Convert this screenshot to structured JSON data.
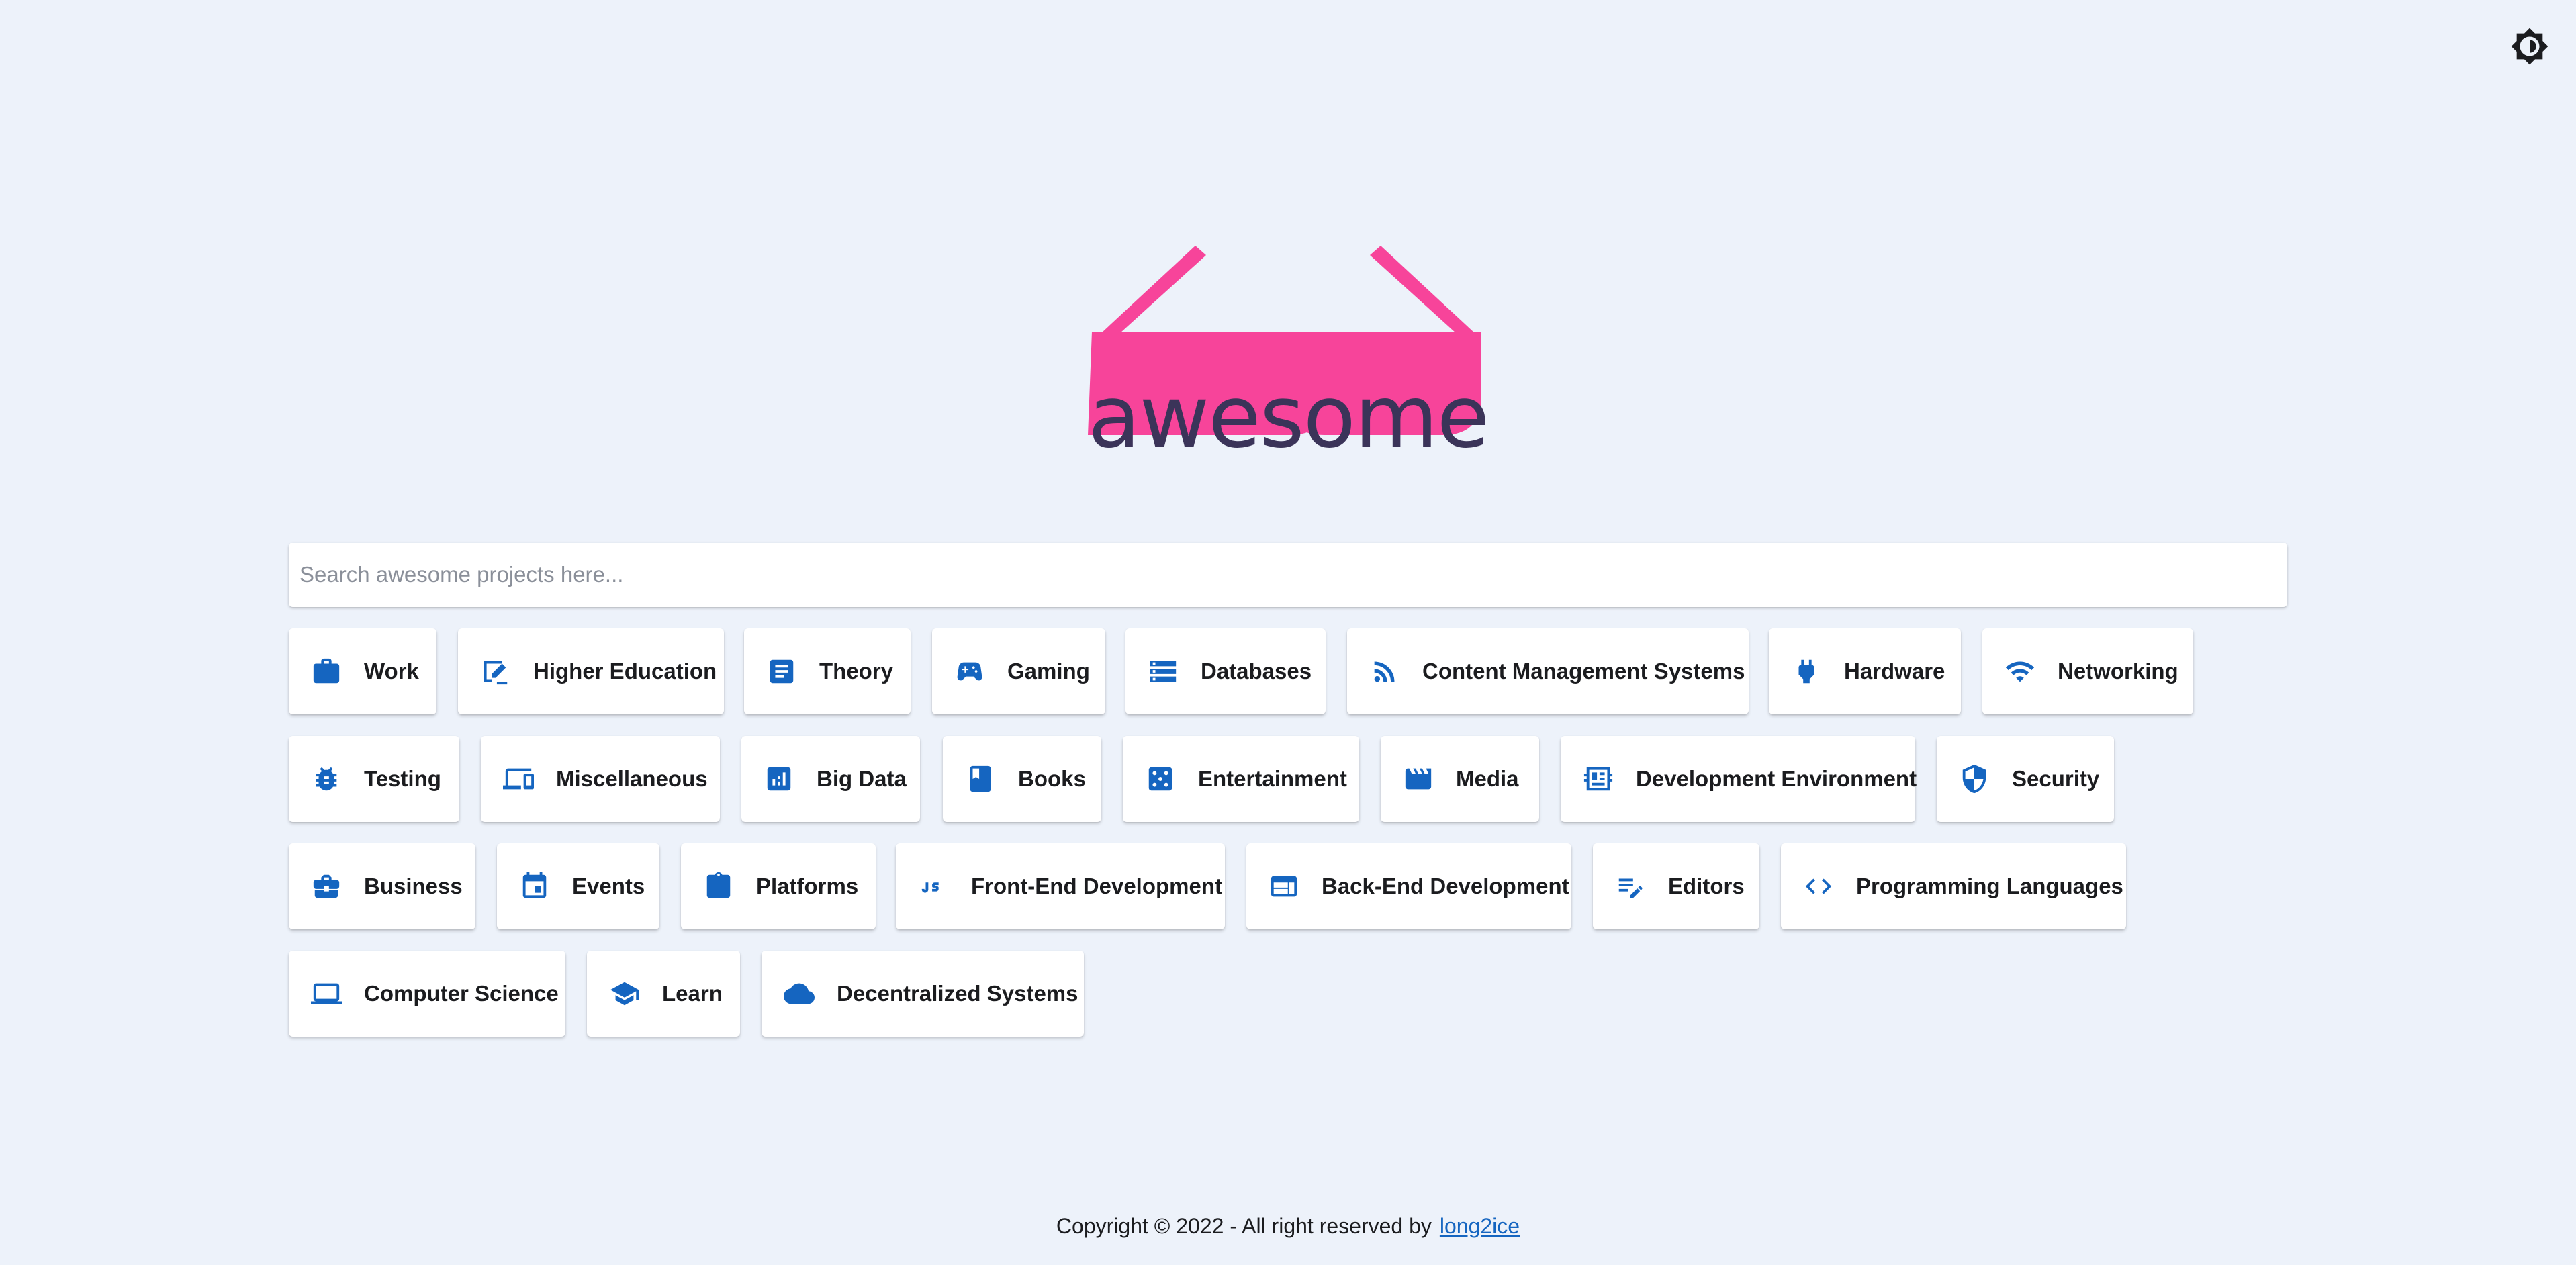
{
  "header": {
    "theme_toggle_icon": "brightness-icon",
    "logo_text": "awesome",
    "logo_color": "#f7449a",
    "wordmark_color": "#3b3459"
  },
  "search": {
    "placeholder": "Search awesome projects here...",
    "value": ""
  },
  "accent_color": "#1565c0",
  "categories": [
    {
      "label": "Work",
      "icon": "briefcase-icon"
    },
    {
      "label": "Higher Education",
      "icon": "draw-icon"
    },
    {
      "label": "Theory",
      "icon": "article-icon"
    },
    {
      "label": "Gaming",
      "icon": "gamepad-icon"
    },
    {
      "label": "Databases",
      "icon": "storage-icon"
    },
    {
      "label": "Content Management Systems",
      "icon": "rss-icon"
    },
    {
      "label": "Hardware",
      "icon": "plug-icon"
    },
    {
      "label": "Networking",
      "icon": "wifi-icon"
    },
    {
      "label": "Testing",
      "icon": "bug-icon"
    },
    {
      "label": "Miscellaneous",
      "icon": "devices-icon"
    },
    {
      "label": "Big Data",
      "icon": "chart-icon"
    },
    {
      "label": "Books",
      "icon": "book-icon"
    },
    {
      "label": "Entertainment",
      "icon": "dice-icon"
    },
    {
      "label": "Media",
      "icon": "movie-icon"
    },
    {
      "label": "Development Environment",
      "icon": "dashboard-icon"
    },
    {
      "label": "Security",
      "icon": "shield-icon"
    },
    {
      "label": "Business",
      "icon": "business-case-icon"
    },
    {
      "label": "Events",
      "icon": "event-icon"
    },
    {
      "label": "Platforms",
      "icon": "integration-icon"
    },
    {
      "label": "Front-End Development",
      "icon": "javascript-icon"
    },
    {
      "label": "Back-End Development",
      "icon": "web-window-icon"
    },
    {
      "label": "Editors",
      "icon": "edit-note-icon"
    },
    {
      "label": "Programming Languages",
      "icon": "code-icon"
    },
    {
      "label": "Computer Science",
      "icon": "laptop-icon"
    },
    {
      "label": "Learn",
      "icon": "school-icon"
    },
    {
      "label": "Decentralized Systems",
      "icon": "cloud-icon"
    }
  ],
  "footer": {
    "text": "Copyright © 2022 - All right reserved by",
    "link_text": "long2ice"
  }
}
